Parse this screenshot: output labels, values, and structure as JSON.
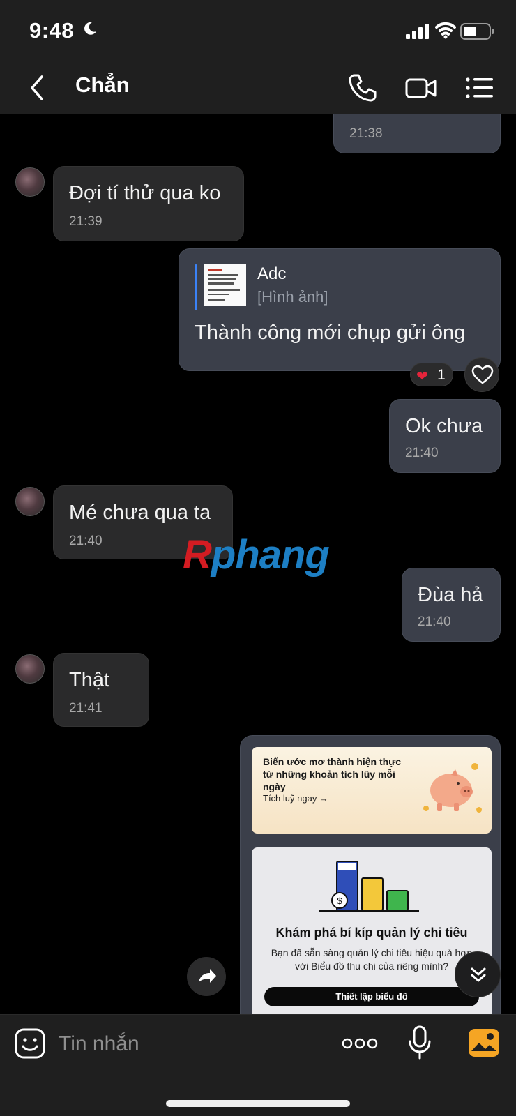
{
  "status_bar": {
    "time": "9:48"
  },
  "header": {
    "contact_name": "Chẳn"
  },
  "messages": [
    {
      "direction": "out",
      "time": "21:38"
    },
    {
      "direction": "in",
      "text": "Đợi tí thử qua ko",
      "time": "21:39"
    },
    {
      "direction": "out",
      "quote": {
        "name": "Adc",
        "type": "[Hình ảnh]"
      },
      "text": "Thành công mới chụp gửi ông",
      "reaction": {
        "emoji": "❤",
        "count": "1"
      }
    },
    {
      "direction": "out",
      "text": "Ok chưa",
      "time": "21:40"
    },
    {
      "direction": "in",
      "text": "Mé chưa qua ta",
      "time": "21:40"
    },
    {
      "direction": "out",
      "text": "Đùa hả",
      "time": "21:40"
    },
    {
      "direction": "in",
      "text": "Thật",
      "time": "21:41"
    }
  ],
  "watermark": {
    "part1": "R",
    "part2": "phang"
  },
  "shared_card": {
    "banner_title": "Biến ước mơ thành hiện thực từ những khoản tích lũy mỗi ngày",
    "banner_link": "Tích luỹ ngay →",
    "promo_title": "Khám phá bí kíp quản lý chi tiêu",
    "promo_desc": "Bạn đã sẵn sàng quản lý chi tiêu hiệu quả hơn với Biểu đồ thu chi của riêng mình?",
    "promo_button": "Thiết lập biểu đồ"
  },
  "composer": {
    "placeholder": "Tin nhắn"
  },
  "colors": {
    "accent_blue": "#3b82f6",
    "heart_red": "#e5243b",
    "outgoing_bubble": "#3b3f4a",
    "incoming_bubble": "#2a2a2b"
  }
}
